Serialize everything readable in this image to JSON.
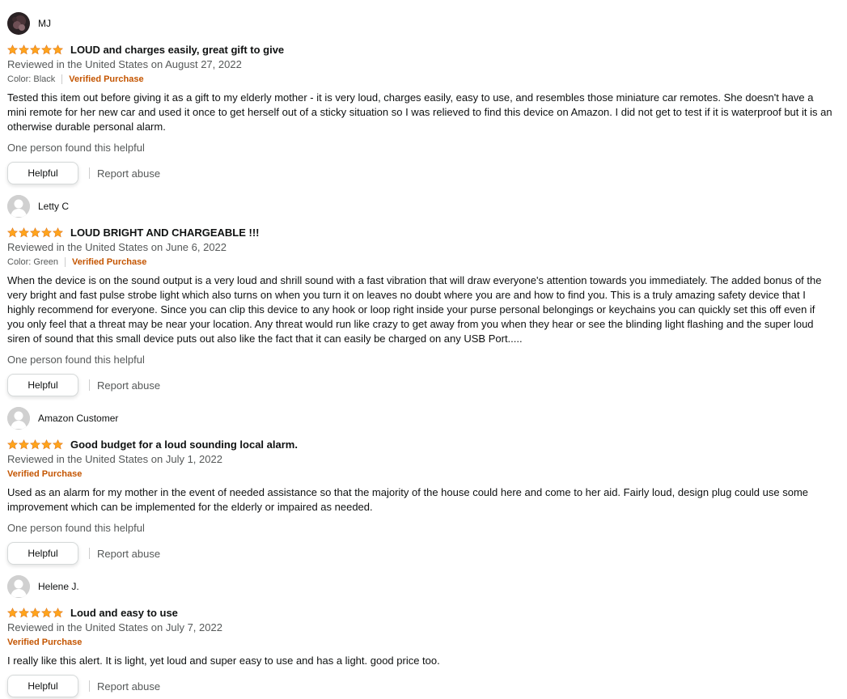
{
  "reviews": [
    {
      "reviewer": "MJ",
      "avatar": "profile-photo",
      "stars": 5,
      "title": "LOUD and charges easily, great gift to give",
      "date": "Reviewed in the United States on August 27, 2022",
      "color": "Color: Black",
      "verified": "Verified Purchase",
      "body": "Tested this item out before giving it as a gift to my elderly mother - it is very loud, charges easily, easy to use, and resembles those miniature car remotes. She doesn't have a mini remote for her new car and used it once to get herself out of a sticky situation so I was relieved to find this device on Amazon. I did not get to test if it is waterproof but it is an otherwise durable personal alarm.",
      "helpful_count": "One person found this helpful",
      "helpful_label": "Helpful",
      "report_label": "Report abuse"
    },
    {
      "reviewer": "Letty C",
      "avatar": "default-user-icon",
      "stars": 5,
      "title": "LOUD BRIGHT AND CHARGEABLE !!!",
      "date": "Reviewed in the United States on June 6, 2022",
      "color": "Color: Green",
      "verified": "Verified Purchase",
      "body": "When the device is on the sound output is a very loud and shrill sound with a fast vibration that will draw everyone's attention towards you immediately. The added bonus of the very bright and fast pulse strobe light which also turns on when you turn it on leaves no doubt where you are and how to find you. This is a truly amazing safety device that I highly recommend for everyone. Since you can clip this device to any hook or loop right inside your purse personal belongings or keychains you can quickly set this off even if you only feel that a threat may be near your location. Any threat would run like crazy to get away from you when they hear or see the blinding light flashing and the super loud siren of sound that this small device puts out also like the fact that it can easily be charged on any USB Port.....",
      "helpful_count": "One person found this helpful",
      "helpful_label": "Helpful",
      "report_label": "Report abuse"
    },
    {
      "reviewer": "Amazon Customer",
      "avatar": "default-user-icon",
      "stars": 5,
      "title": "Good budget for a loud sounding local alarm.",
      "date": "Reviewed in the United States on July 1, 2022",
      "verified": "Verified Purchase",
      "body": "Used as an alarm for my mother in the event of needed assistance so that the majority of the house could here and come to her aid. Fairly loud, design plug could use some improvement which can be implemented for the elderly or impaired as needed.",
      "helpful_count": "One person found this helpful",
      "helpful_label": "Helpful",
      "report_label": "Report abuse"
    },
    {
      "reviewer": "Helene J.",
      "avatar": "default-user-icon",
      "stars": 5,
      "title": "Loud and easy to use",
      "date": "Reviewed in the United States on July 7, 2022",
      "verified": "Verified Purchase",
      "body": "I really like this alert. It is light, yet loud and super easy to use and has a light. good price too.",
      "helpful_label": "Helpful",
      "report_label": "Report abuse"
    }
  ],
  "colors": {
    "star": "#ffa41c",
    "verified": "#c45500",
    "muted": "#565959"
  }
}
